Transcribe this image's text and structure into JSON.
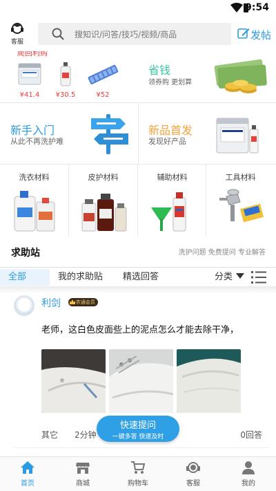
{
  "status_bar": {
    "time": "9:54"
  },
  "header": {
    "kefu_label": "客服",
    "search_placeholder": "搜知识/问答/技巧/视频/商品",
    "post_label": "发帖"
  },
  "products": {
    "cut_text": "爬回利购",
    "items": [
      {
        "price": "¥41.4"
      },
      {
        "price": "¥30.5"
      },
      {
        "price": "¥52"
      }
    ]
  },
  "promo": {
    "title": "省钱",
    "subtitle": "领券购 更划算"
  },
  "cards": [
    {
      "title": "新手入门",
      "subtitle": "从此不再洗护难"
    },
    {
      "title": "新品首发",
      "subtitle": "发现好产品"
    }
  ],
  "categories": [
    {
      "label": "洗衣材料"
    },
    {
      "label": "皮护材料"
    },
    {
      "label": "辅助材料"
    },
    {
      "label": "工具材料"
    }
  ],
  "help_section": {
    "title": "求助站",
    "subtitle": "洗护问题 免费提问 专业解答"
  },
  "tabs": [
    "全部",
    "我的求助贴",
    "精选回答"
  ],
  "filter_label": "分类",
  "post": {
    "user": "利剑",
    "badge": "农通会员",
    "question": "老师，这白色皮面些上的泥点怎么才能去除干净，",
    "category": "其它",
    "time": "2分钟",
    "answers": "0回答"
  },
  "fab": {
    "title": "快速提问",
    "subtitle": "一键多答 快速及时"
  },
  "tabbar": [
    {
      "label": "首页"
    },
    {
      "label": "商城"
    },
    {
      "label": "购物车"
    },
    {
      "label": "客服"
    },
    {
      "label": "我的"
    }
  ],
  "colors": {
    "accent": "#2b9be3",
    "price": "#e5413d",
    "teal": "#3bc4a8",
    "orange": "#f5a23a"
  }
}
